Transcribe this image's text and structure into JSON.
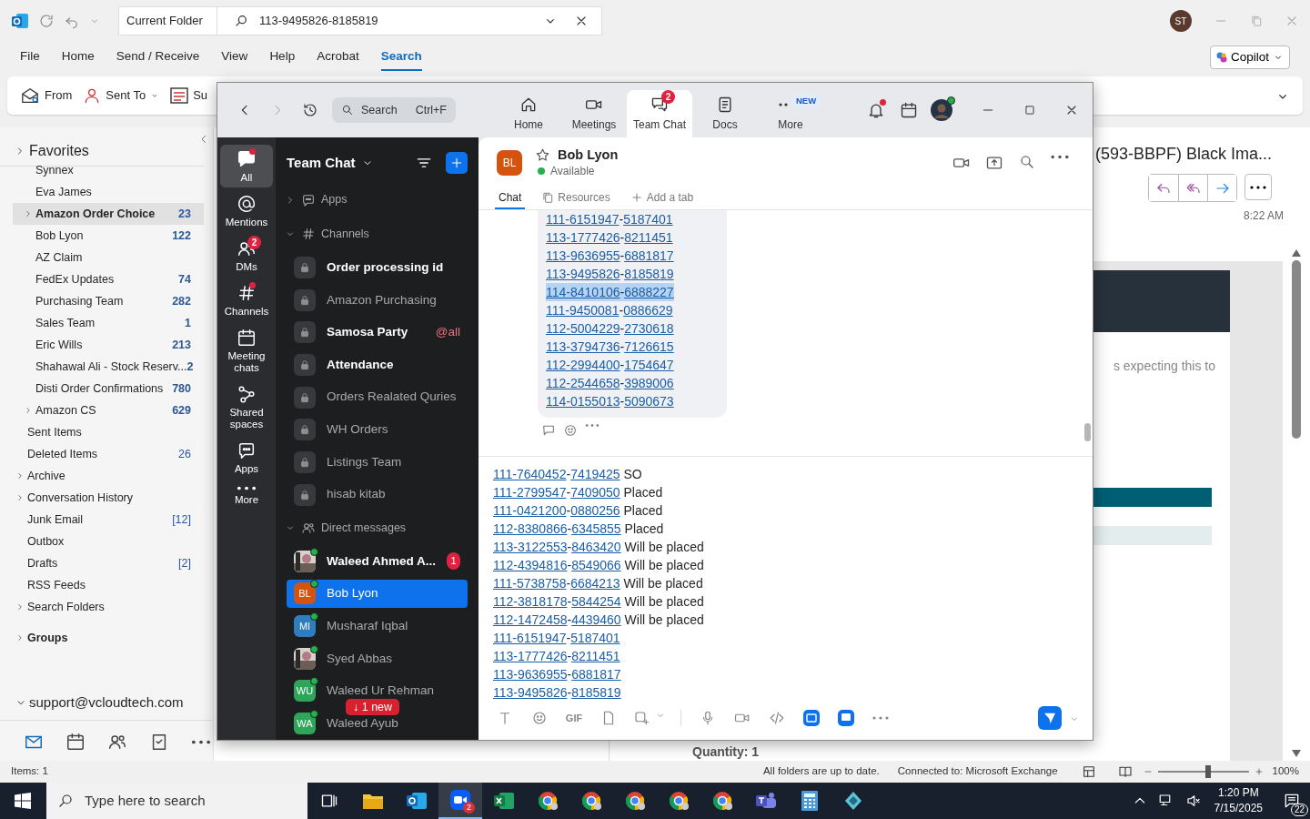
{
  "outlook": {
    "title_bar": {
      "scope": "Current Folder",
      "search_value": "113-9495826-8185819",
      "initials": "ST"
    },
    "menu": [
      {
        "label": "File",
        "selected": false
      },
      {
        "label": "Home",
        "selected": false
      },
      {
        "label": "Send / Receive",
        "selected": false
      },
      {
        "label": "View",
        "selected": false
      },
      {
        "label": "Help",
        "selected": false
      },
      {
        "label": "Acrobat",
        "selected": false
      },
      {
        "label": "Search",
        "selected": true
      }
    ],
    "copilot": "Copilot",
    "ribbon": [
      {
        "label": "From",
        "kind": "from",
        "dropdown": false
      },
      {
        "label": "Sent To",
        "kind": "sent",
        "dropdown": true
      },
      {
        "label": "Su",
        "kind": "subject",
        "dropdown": false
      }
    ],
    "favorites": "Favorites",
    "inbox_folders": [
      {
        "name": "Synnex",
        "selected": false,
        "expandable": false
      },
      {
        "name": "Eva James",
        "selected": false,
        "expandable": false
      },
      {
        "name": "Amazon Order Choice",
        "count": "23",
        "selected": true,
        "expandable": true
      },
      {
        "name": "Bob Lyon",
        "count": "122",
        "selected": false,
        "expandable": false
      },
      {
        "name": "AZ Claim",
        "selected": false,
        "expandable": false
      },
      {
        "name": "FedEx Updates",
        "count": "74",
        "selected": false,
        "expandable": false
      },
      {
        "name": "Purchasing Team",
        "count": "282",
        "selected": false,
        "expandable": false
      },
      {
        "name": "Sales Team",
        "count": "1",
        "selected": false,
        "expandable": false
      },
      {
        "name": "Eric Wills",
        "count": "213",
        "selected": false,
        "expandable": false
      },
      {
        "name": "Shahawal Ali - Stock Reserv...",
        "count": "2",
        "selected": false,
        "expandable": false
      },
      {
        "name": "Disti Order Confirmations",
        "count": "780",
        "selected": false,
        "expandable": false
      },
      {
        "name": "Amazon CS",
        "count": "629",
        "selected": false,
        "expandable": true
      }
    ],
    "folders": [
      {
        "name": "Sent Items",
        "expandable": false
      },
      {
        "name": "Deleted Items",
        "count": "26",
        "expandable": false
      },
      {
        "name": "Archive",
        "expandable": true
      },
      {
        "name": "Conversation History",
        "expandable": true
      },
      {
        "name": "Junk Email",
        "count": "[12]",
        "expandable": false
      },
      {
        "name": "Outbox",
        "expandable": false
      },
      {
        "name": "Drafts",
        "count": "[2]",
        "expandable": false
      },
      {
        "name": "RSS Feeds",
        "expandable": false
      },
      {
        "name": "Search Folders",
        "expandable": true
      }
    ],
    "groups": "Groups",
    "account": "support@vcloudtech.com",
    "reading_pane": {
      "subject": "(593-BBPF) Black Ima...",
      "time": "8:22 AM",
      "body_text": "s expecting this to",
      "quantity": "Quantity: 1"
    },
    "status_bar": {
      "items": "Items: 1",
      "sync": "All folders are up to date.",
      "connection": "Connected to: Microsoft Exchange",
      "zoom_label": "100%",
      "zoom_slider": {
        "level": 0.55
      }
    }
  },
  "zoom": {
    "search": {
      "placeholder": "Search",
      "shortcut": "Ctrl+F"
    },
    "tabs": [
      {
        "label": "Home",
        "kind": "home",
        "selected": false
      },
      {
        "label": "Meetings",
        "kind": "meetings",
        "selected": false
      },
      {
        "label": "Team Chat",
        "kind": "chat",
        "selected": true,
        "badge": "2"
      },
      {
        "label": "Docs",
        "kind": "docs",
        "selected": false
      },
      {
        "label": "More",
        "kind": "more",
        "selected": false,
        "tag": "NEW"
      }
    ],
    "rail": [
      {
        "label": "All",
        "kind": "all",
        "selected": true,
        "dot": true
      },
      {
        "label": "Mentions",
        "kind": "mentions",
        "selected": false,
        "dot": false
      },
      {
        "label": "DMs",
        "kind": "dms",
        "selected": false,
        "dot": false,
        "badge": "2"
      },
      {
        "label": "Channels",
        "kind": "channels",
        "selected": false,
        "dot": true
      },
      {
        "label": "Meeting chats",
        "kind": "meeting",
        "selected": false,
        "dot": false
      },
      {
        "label": "Shared spaces",
        "kind": "spaces",
        "selected": false,
        "dot": false
      },
      {
        "label": "Apps",
        "kind": "apps",
        "selected": false,
        "dot": false
      },
      {
        "label": "More",
        "kind": "more",
        "selected": false,
        "dot": false
      }
    ],
    "list_title": "Team Chat",
    "sections": [
      {
        "label": "Apps",
        "kind": "apps",
        "expanded": false
      },
      {
        "label": "Channels",
        "kind": "channels",
        "expanded": true,
        "items": [
          {
            "name": "Order processing id",
            "unread": true
          },
          {
            "name": "Amazon Purchasing",
            "unread": false
          },
          {
            "name": "Samosa Party",
            "unread": true,
            "mention": "@all"
          },
          {
            "name": "Attendance",
            "unread": true
          },
          {
            "name": "Orders Realated Quries",
            "unread": false
          },
          {
            "name": "WH Orders",
            "unread": false
          },
          {
            "name": "Listings Team",
            "unread": false
          },
          {
            "name": "hisab kitab",
            "unread": false
          }
        ]
      },
      {
        "label": "Direct messages",
        "kind": "dms",
        "expanded": true,
        "items": [
          {
            "name": "Waleed Ahmed A...",
            "unread": true,
            "badge": "1",
            "selected": false
          },
          {
            "name": "Bob Lyon",
            "kind": "initials",
            "initials": "BL",
            "color": "#d4540f",
            "unread": false,
            "selected": true
          },
          {
            "name": "Musharaf Iqbal",
            "kind": "initials",
            "initials": "MI",
            "color": "#2f7dc1",
            "unread": false,
            "selected": false
          },
          {
            "name": "Syed Abbas",
            "unread": false,
            "selected": false
          },
          {
            "name": "Waleed Ur Rehman",
            "kind": "initials",
            "initials": "WU",
            "color": "#2ea65a",
            "unread": false,
            "selected": false
          },
          {
            "name": "Waleed Ayub",
            "kind": "initials",
            "initials": "WA",
            "color": "#2ea65a",
            "unread": false,
            "selected": false
          }
        ]
      }
    ],
    "new_pill": "↓ 1 new",
    "chat": {
      "contact": {
        "initials": "BL",
        "name": "Bob Lyon",
        "status": "Available",
        "starred": false
      },
      "tabs": [
        {
          "label": "Chat",
          "kind": "chat",
          "selected": true
        },
        {
          "label": "Resources",
          "kind": "resources",
          "selected": false
        },
        {
          "label": "Add a tab",
          "kind": "add",
          "selected": false
        }
      ],
      "message_lines": [
        {
          "text": "111-6151947-5187401",
          "highlighted": false
        },
        {
          "text": "113-1777426-8211451",
          "highlighted": false
        },
        {
          "text": "113-9636955-6881817",
          "highlighted": false
        },
        {
          "text": "113-9495826-8185819",
          "highlighted": false
        },
        {
          "text": "114-8410106-6888227",
          "highlighted": true
        },
        {
          "text": "111-9450081-0886629",
          "highlighted": false
        },
        {
          "text": "112-5004229-2730618",
          "highlighted": false
        },
        {
          "text": "113-3794736-7126615",
          "highlighted": false
        },
        {
          "text": "112-2994400-1754647",
          "highlighted": false
        },
        {
          "text": "112-2544658-3989006",
          "highlighted": false
        },
        {
          "text": "114-0155013-5090673",
          "highlighted": false
        }
      ],
      "draft_lines": [
        {
          "text": "111-7640452-7419425",
          "note": "SO"
        },
        {
          "text": "111-2799547-7409050",
          "note": "Placed"
        },
        {
          "text": "111-0421200-0880256",
          "note": "Placed"
        },
        {
          "text": "112-8380866-6345855",
          "note": "Placed"
        },
        {
          "text": "113-3122553-8463420",
          "note": "Will be placed"
        },
        {
          "text": "112-4394816-8549066",
          "note": "Will be placed"
        },
        {
          "text": "111-5738758-6684213",
          "note": "Will be placed"
        },
        {
          "text": "112-3818178-5844254",
          "note": "Will be placed"
        },
        {
          "text": "112-1472458-4439460",
          "note": "Will be placed"
        },
        {
          "text": "111-6151947-5187401"
        },
        {
          "text": "113-1777426-8211451"
        },
        {
          "text": "113-9636955-6881817"
        },
        {
          "text": "113-9495826-8185819"
        }
      ],
      "gif_label": "GIF"
    }
  },
  "taskbar": {
    "search_placeholder": "Type here to search",
    "app_badge": "2",
    "time": "1:20 PM",
    "date": "7/15/2025",
    "notifications": "22"
  }
}
